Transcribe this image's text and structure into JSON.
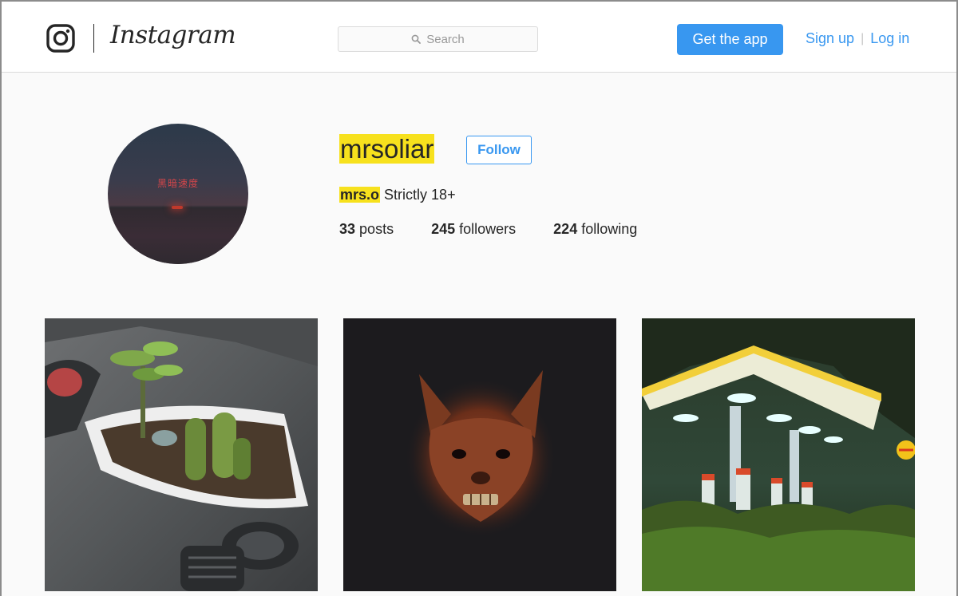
{
  "header": {
    "brand": "Instagram",
    "logo_icon": "instagram-camera-icon",
    "search_icon": "search-icon",
    "search_placeholder": "Search",
    "get_app_label": "Get the app",
    "signup_label": "Sign up",
    "login_label": "Log in",
    "separator": "|"
  },
  "profile": {
    "username": "mrsoliar",
    "follow_label": "Follow",
    "bio_name": "mrs.o",
    "bio_text": "Strictly 18+",
    "avatar_text": "黑暗速度",
    "stats": {
      "posts_count": "33",
      "posts_label": "posts",
      "followers_count": "245",
      "followers_label": "followers",
      "following_count": "224",
      "following_label": "following"
    }
  },
  "posts": [
    {
      "subject": "cactus planter on car dashboard"
    },
    {
      "subject": "creature face painting on black"
    },
    {
      "subject": "overgrown gas station at night",
      "sign_icon": "shell-logo-icon"
    }
  ],
  "colors": {
    "accent": "#3897f0",
    "highlight": "#f7e11d",
    "text": "#262626",
    "background": "#fafafa"
  }
}
